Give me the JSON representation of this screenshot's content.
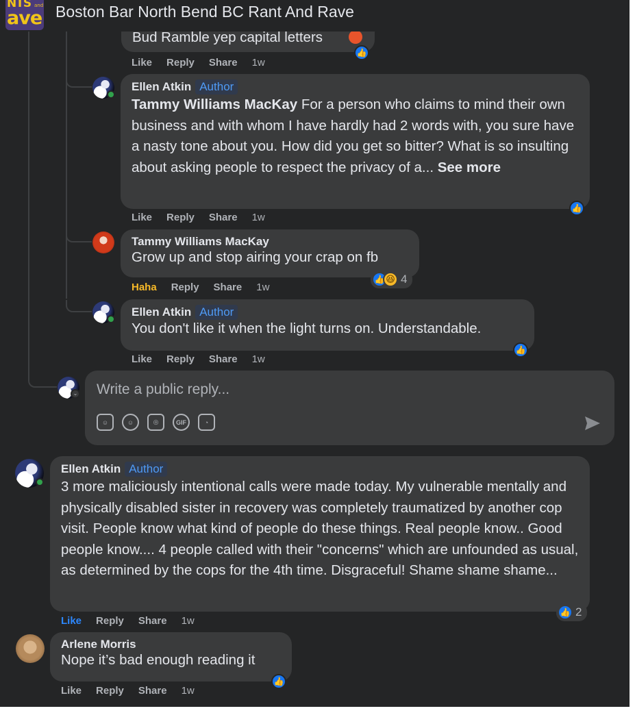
{
  "group": {
    "logo_text_top": "NTS",
    "logo_text_main": "ave",
    "logo_text_small": "and",
    "title": "Boston Bar North Bend BC Rant And Rave"
  },
  "partial_comment": {
    "text": "Bud Ramble yep capital letters",
    "actions": {
      "like": "Like",
      "reply": "Reply",
      "share": "Share",
      "time": "1w"
    }
  },
  "comments": [
    {
      "author": "Ellen Atkin",
      "badge": "Author",
      "mention": "Tammy Williams MacKay",
      "text": " For a person who claims to mind their own business and with whom I have hardly had 2 words with, you sure have a nasty tone about you. How did you get so bitter? What is so insulting about asking people to respect the privacy of a... ",
      "see_more": "See more",
      "actions": {
        "like": "Like",
        "reply": "Reply",
        "share": "Share",
        "time": "1w"
      },
      "reactions": {
        "icons": [
          "like-icon"
        ],
        "count": ""
      }
    },
    {
      "author": "Tammy Williams MacKay",
      "text": "Grow up and stop airing your crap on fb",
      "actions": {
        "like": "Haha",
        "reply": "Reply",
        "share": "Share",
        "time": "1w"
      },
      "reactions": {
        "icons": [
          "like-icon",
          "haha-icon"
        ],
        "count": "4"
      }
    },
    {
      "author": "Ellen Atkin",
      "badge": "Author",
      "text": "You don't like it when the light turns on. Understandable.",
      "actions": {
        "like": "Like",
        "reply": "Reply",
        "share": "Share",
        "time": "1w"
      },
      "reactions": {
        "icons": [
          "like-icon"
        ],
        "count": ""
      }
    },
    {
      "author": "Ellen Atkin",
      "badge": "Author",
      "text": "3 more maliciously intentional calls were made today. My vulnerable mentally and physically disabled sister in recovery was completely traumatized by another cop visit. People know what kind of people do these things. Real people know.. Good people know.... 4 people called with their \"concerns\" which are unfounded as usual, as determined by the cops for the 4th time. Disgraceful! Shame shame shame...",
      "actions": {
        "like": "Like",
        "reply": "Reply",
        "share": "Share",
        "time": "1w"
      },
      "reactions": {
        "icons": [
          "like-icon"
        ],
        "count": "2"
      }
    },
    {
      "author": "Arlene Morris",
      "text": "Nope it’s bad enough reading it",
      "actions": {
        "like": "Like",
        "reply": "Reply",
        "share": "Share",
        "time": "1w"
      },
      "reactions": {
        "icons": [
          "like-icon"
        ],
        "count": ""
      }
    }
  ],
  "reply_box": {
    "placeholder": "Write a public reply...",
    "tools": [
      "avatar-sticker-icon",
      "emoji-icon",
      "camera-icon",
      "gif-icon",
      "sticker-icon"
    ],
    "gif_label": "GIF"
  },
  "colors": {
    "background": "#242526",
    "bubble": "#3a3b3c",
    "text": "#e4e6eb",
    "secondary_text": "#b0b3b8",
    "link_blue": "#2d88ff",
    "haha_yellow": "#f7b928",
    "online_green": "#31a24c"
  }
}
